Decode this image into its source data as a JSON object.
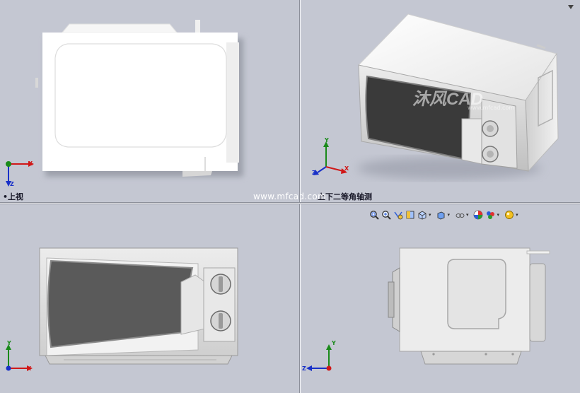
{
  "viewports": {
    "top_left": {
      "label": "上视"
    },
    "top_right": {
      "label": "上下二等角轴测"
    }
  },
  "watermark": {
    "url_text": "www.mfcad.com",
    "logo_text": "沐风CAD",
    "logo_sub": "www.mfcad.com"
  },
  "triad_axes": {
    "x": "X",
    "y": "Y",
    "z": "Z"
  },
  "toolbar": {
    "items": [
      {
        "icon": "zoom-to-fit-icon"
      },
      {
        "icon": "zoom-area-icon"
      },
      {
        "icon": "previous-view-icon"
      },
      {
        "icon": "section-view-icon"
      },
      {
        "icon": "view-orientation-icon"
      },
      {
        "icon": "display-style-icon"
      },
      {
        "icon": "hide-show-items-icon"
      },
      {
        "icon": "edit-appearance-icon"
      },
      {
        "icon": "apply-scene-icon"
      },
      {
        "icon": "view-settings-icon"
      }
    ]
  },
  "colors": {
    "viewport_bg": "#c4c7d2",
    "triad_x": "#d01818",
    "triad_y": "#1a8a1a",
    "triad_z": "#1830c8"
  }
}
